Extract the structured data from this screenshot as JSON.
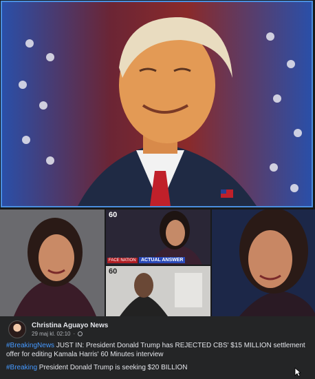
{
  "images": {
    "top_alt": "Donald Trump smiling in front of American flags",
    "grid_alt": "Kamala Harris collage from 60 Minutes interview"
  },
  "overlay": {
    "badge_60_top": "60",
    "badge_60_bottom": "60",
    "face_nation": "FACE NATION",
    "actual_answer": "ACTUAL ANSWER"
  },
  "post": {
    "author": "Christina Aguayo News",
    "timestamp": "29 maj kl. 02:10",
    "separator": "·",
    "hashtag1": "#BreakingNews",
    "text1": " JUST IN: President Donald Trump has REJECTED CBS' $15 MILLION settlement offer for editing Kamala Harris' 60 Minutes interview",
    "hashtag2": "#Breaking",
    "text2": " President Donald  Trump is seeking $20 BILLION"
  },
  "colors": {
    "background": "#18191a",
    "card": "#242526",
    "hashtag": "#4599ff",
    "selection_border": "#4a8fe0"
  }
}
